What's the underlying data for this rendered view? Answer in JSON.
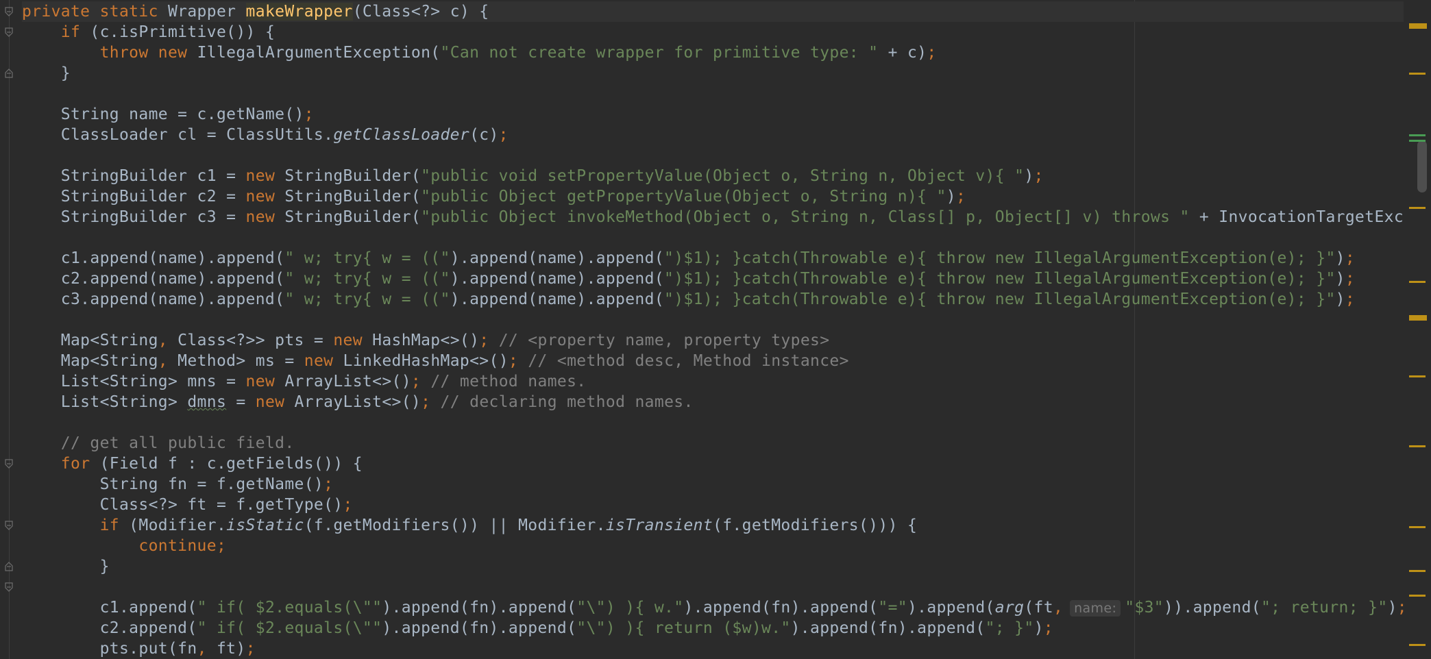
{
  "editor": {
    "lines": [
      [
        {
          "t": "private static ",
          "c": "k"
        },
        {
          "t": "Wrapper "
        },
        {
          "t": "makeWrapper",
          "c": "fn hl"
        },
        {
          "t": "(Class<?> c) {"
        }
      ],
      [
        {
          "t": "    "
        },
        {
          "t": "if ",
          "c": "k"
        },
        {
          "t": "(c.isPrimitive()) {"
        }
      ],
      [
        {
          "t": "        "
        },
        {
          "t": "throw new ",
          "c": "k"
        },
        {
          "t": "IllegalArgumentException("
        },
        {
          "t": "\"Can not create wrapper for primitive type: \" ",
          "c": "s"
        },
        {
          "t": "+ c)"
        },
        {
          "t": ";",
          "c": "k"
        }
      ],
      [
        {
          "t": "    }"
        }
      ],
      [],
      [
        {
          "t": "    String name = c.getName()"
        },
        {
          "t": ";",
          "c": "k"
        }
      ],
      [
        {
          "t": "    ClassLoader cl = ClassUtils."
        },
        {
          "t": "getClassLoader",
          "c": "it"
        },
        {
          "t": "(c)"
        },
        {
          "t": ";",
          "c": "k"
        }
      ],
      [],
      [
        {
          "t": "    StringBuilder c1 = "
        },
        {
          "t": "new ",
          "c": "k"
        },
        {
          "t": "StringBuilder("
        },
        {
          "t": "\"public void setPropertyValue(Object o, String n, Object v){ \"",
          "c": "s"
        },
        {
          "t": ")"
        },
        {
          "t": ";",
          "c": "k"
        }
      ],
      [
        {
          "t": "    StringBuilder c2 = "
        },
        {
          "t": "new ",
          "c": "k"
        },
        {
          "t": "StringBuilder("
        },
        {
          "t": "\"public Object getPropertyValue(Object o, String n){ \"",
          "c": "s"
        },
        {
          "t": ")"
        },
        {
          "t": ";",
          "c": "k"
        }
      ],
      [
        {
          "t": "    StringBuilder c3 = "
        },
        {
          "t": "new ",
          "c": "k"
        },
        {
          "t": "StringBuilder("
        },
        {
          "t": "\"public Object invokeMethod(Object o, String n, Class[] p, Object[] v) throws \" ",
          "c": "s"
        },
        {
          "t": "+ InvocationTargetExcepti"
        }
      ],
      [],
      [
        {
          "t": "    c1.append(name).append("
        },
        {
          "t": "\" w; try{ w = ((\"",
          "c": "s"
        },
        {
          "t": ").append(name).append("
        },
        {
          "t": "\")$1); }catch(Throwable e){ throw new IllegalArgumentException(e); }\"",
          "c": "s"
        },
        {
          "t": ")"
        },
        {
          "t": ";",
          "c": "k"
        }
      ],
      [
        {
          "t": "    c2.append(name).append("
        },
        {
          "t": "\" w; try{ w = ((\"",
          "c": "s"
        },
        {
          "t": ").append(name).append("
        },
        {
          "t": "\")$1); }catch(Throwable e){ throw new IllegalArgumentException(e); }\"",
          "c": "s"
        },
        {
          "t": ")"
        },
        {
          "t": ";",
          "c": "k"
        }
      ],
      [
        {
          "t": "    c3.append(name).append("
        },
        {
          "t": "\" w; try{ w = ((\"",
          "c": "s"
        },
        {
          "t": ").append(name).append("
        },
        {
          "t": "\")$1); }catch(Throwable e){ throw new IllegalArgumentException(e); }\"",
          "c": "s"
        },
        {
          "t": ")"
        },
        {
          "t": ";",
          "c": "k"
        }
      ],
      [],
      [
        {
          "t": "    Map<String"
        },
        {
          "t": ", ",
          "c": "k"
        },
        {
          "t": "Class<?>> pts = "
        },
        {
          "t": "new ",
          "c": "k"
        },
        {
          "t": "HashMap<>()"
        },
        {
          "t": "; ",
          "c": "k"
        },
        {
          "t": "// <property name, property types>",
          "c": "c"
        }
      ],
      [
        {
          "t": "    Map<String"
        },
        {
          "t": ", ",
          "c": "k"
        },
        {
          "t": "Method> ms = "
        },
        {
          "t": "new ",
          "c": "k"
        },
        {
          "t": "LinkedHashMap<>()"
        },
        {
          "t": "; ",
          "c": "k"
        },
        {
          "t": "// <method desc, Method instance>",
          "c": "c"
        }
      ],
      [
        {
          "t": "    List<String> mns = "
        },
        {
          "t": "new ",
          "c": "k"
        },
        {
          "t": "ArrayList<>()"
        },
        {
          "t": "; ",
          "c": "k"
        },
        {
          "t": "// method names.",
          "c": "c"
        }
      ],
      [
        {
          "t": "    List<String> "
        },
        {
          "t": "dmns",
          "c": "wavy"
        },
        {
          "t": " = "
        },
        {
          "t": "new ",
          "c": "k"
        },
        {
          "t": "ArrayList<>()"
        },
        {
          "t": "; ",
          "c": "k"
        },
        {
          "t": "// declaring method names.",
          "c": "c"
        }
      ],
      [],
      [
        {
          "t": "    "
        },
        {
          "t": "// get all public field.",
          "c": "c"
        }
      ],
      [
        {
          "t": "    "
        },
        {
          "t": "for ",
          "c": "k"
        },
        {
          "t": "(Field f : c.getFields()) {"
        }
      ],
      [
        {
          "t": "        String fn = f.getName()"
        },
        {
          "t": ";",
          "c": "k"
        }
      ],
      [
        {
          "t": "        Class<?> ft = f.getType()"
        },
        {
          "t": ";",
          "c": "k"
        }
      ],
      [
        {
          "t": "        "
        },
        {
          "t": "if ",
          "c": "k"
        },
        {
          "t": "(Modifier."
        },
        {
          "t": "isStatic",
          "c": "it"
        },
        {
          "t": "(f.getModifiers()) || Modifier."
        },
        {
          "t": "isTransient",
          "c": "it"
        },
        {
          "t": "(f.getModifiers())) {"
        }
      ],
      [
        {
          "t": "            "
        },
        {
          "t": "continue;",
          "c": "k"
        }
      ],
      [
        {
          "t": "        }"
        }
      ],
      [],
      [
        {
          "t": "        c1.append("
        },
        {
          "t": "\" if( $2.equals(\\\"\"",
          "c": "s"
        },
        {
          "t": ").append(fn).append("
        },
        {
          "t": "\"\\\") ){ w.\"",
          "c": "s"
        },
        {
          "t": ").append(fn).append("
        },
        {
          "t": "\"=\"",
          "c": "s"
        },
        {
          "t": ").append("
        },
        {
          "t": "arg",
          "c": "it"
        },
        {
          "t": "(ft"
        },
        {
          "t": ",",
          "c": "k"
        },
        {
          "hint": "name:"
        },
        {
          "t": "\"$3\"",
          "c": "s"
        },
        {
          "t": ")).append("
        },
        {
          "t": "\"; return; }\"",
          "c": "s"
        },
        {
          "t": ")"
        },
        {
          "t": ";",
          "c": "k"
        }
      ],
      [
        {
          "t": "        c2.append("
        },
        {
          "t": "\" if( $2.equals(\\\"\"",
          "c": "s"
        },
        {
          "t": ").append(fn).append("
        },
        {
          "t": "\"\\\") ){ return ($w)w.\"",
          "c": "s"
        },
        {
          "t": ").append(fn).append("
        },
        {
          "t": "\"; }\"",
          "c": "s"
        },
        {
          "t": ")"
        },
        {
          "t": ";",
          "c": "k"
        }
      ],
      [
        {
          "t": "        pts.put(fn"
        },
        {
          "t": ", ",
          "c": "k"
        },
        {
          "t": "ft)"
        },
        {
          "t": ";",
          "c": "k"
        }
      ]
    ]
  },
  "gutter": {
    "fold_icons": [
      "fold-start-icon",
      "fold-start-icon",
      "fold-end-icon",
      "fold-start-icon",
      "fold-start-icon",
      "fold-end-icon",
      "fold-start-icon"
    ]
  },
  "scrollbar": {
    "marker_colors": {
      "warning": "#be9117",
      "change": "#499c54"
    }
  },
  "colors": {
    "background": "#2b2b2b",
    "text": "#a9b7c6",
    "keyword": "#cc7832",
    "string": "#6a8759",
    "comment": "#808080",
    "method_declaration": "#ffc66d"
  }
}
